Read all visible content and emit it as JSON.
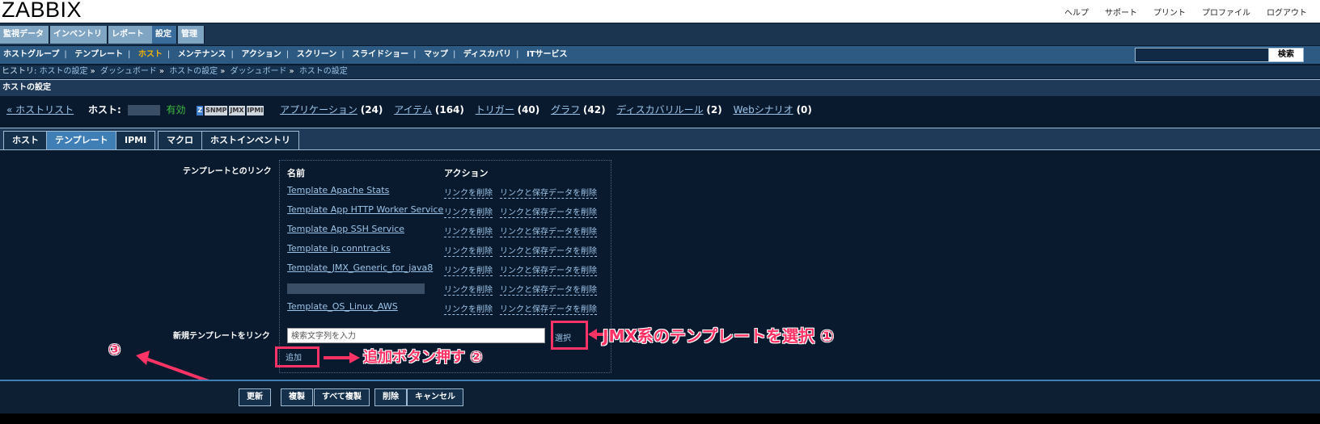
{
  "header": {
    "logo": "ZABBIX",
    "links": [
      "ヘルプ",
      "サポート",
      "プリント",
      "プロファイル",
      "ログアウト"
    ]
  },
  "main_menu": [
    "監視データ",
    "インベントリ",
    "レポート",
    "設定",
    "管理"
  ],
  "sub_menu": [
    "ホストグループ",
    "テンプレート",
    "ホスト",
    "メンテナンス",
    "アクション",
    "スクリーン",
    "スライドショー",
    "マップ",
    "ディスカバリ",
    "ITサービス"
  ],
  "search": {
    "button": "検索",
    "value": ""
  },
  "history": {
    "label": "ヒストリ:",
    "items": [
      "ホストの設定",
      "ダッシュボード",
      "ホストの設定",
      "ダッシュボード",
      "ホストの設定"
    ]
  },
  "page_title": "ホストの設定",
  "hostbar": {
    "back": "« ホストリスト",
    "host_label": "ホスト:",
    "status": "有効",
    "badges": [
      "Z",
      "SNMP",
      "JMX",
      "IPMI"
    ],
    "links": [
      {
        "label": "アプリケーション",
        "count": "(24)"
      },
      {
        "label": "アイテム",
        "count": "(164)"
      },
      {
        "label": "トリガー",
        "count": "(40)"
      },
      {
        "label": "グラフ",
        "count": "(42)"
      },
      {
        "label": "ディスカバリルール",
        "count": "(2)"
      },
      {
        "label": "Webシナリオ",
        "count": "(0)"
      }
    ]
  },
  "tabs": [
    "ホスト",
    "テンプレート",
    "IPMI",
    "マクロ",
    "ホストインベントリ"
  ],
  "form": {
    "linked_label": "テンプレートとのリンク",
    "col_name": "名前",
    "col_action": "アクション",
    "templates": [
      "Template Apache Stats",
      "Template App HTTP Worker Service",
      "Template App SSH Service",
      "Template ip conntracks",
      "Template_JMX_Generic_for_java8",
      "",
      "Template_OS_Linux_AWS"
    ],
    "unlink": "リンクを削除",
    "unlink_clear": "リンクと保存データを削除",
    "new_label": "新規テンプレートをリンク",
    "new_placeholder": "検索文字列を入力",
    "select": "選択",
    "add": "追加"
  },
  "buttons": [
    "更新",
    "複製",
    "すべて複製",
    "削除",
    "キャンセル"
  ],
  "annotations": {
    "select_note": "JMX系のテンプレートを選択 ①",
    "add_note": "追加ボタン押す ②",
    "update_note": "③"
  },
  "colors": {
    "accent": "#3f7fb6",
    "annotation": "#ff3366",
    "current_menu": "#f4b400"
  }
}
